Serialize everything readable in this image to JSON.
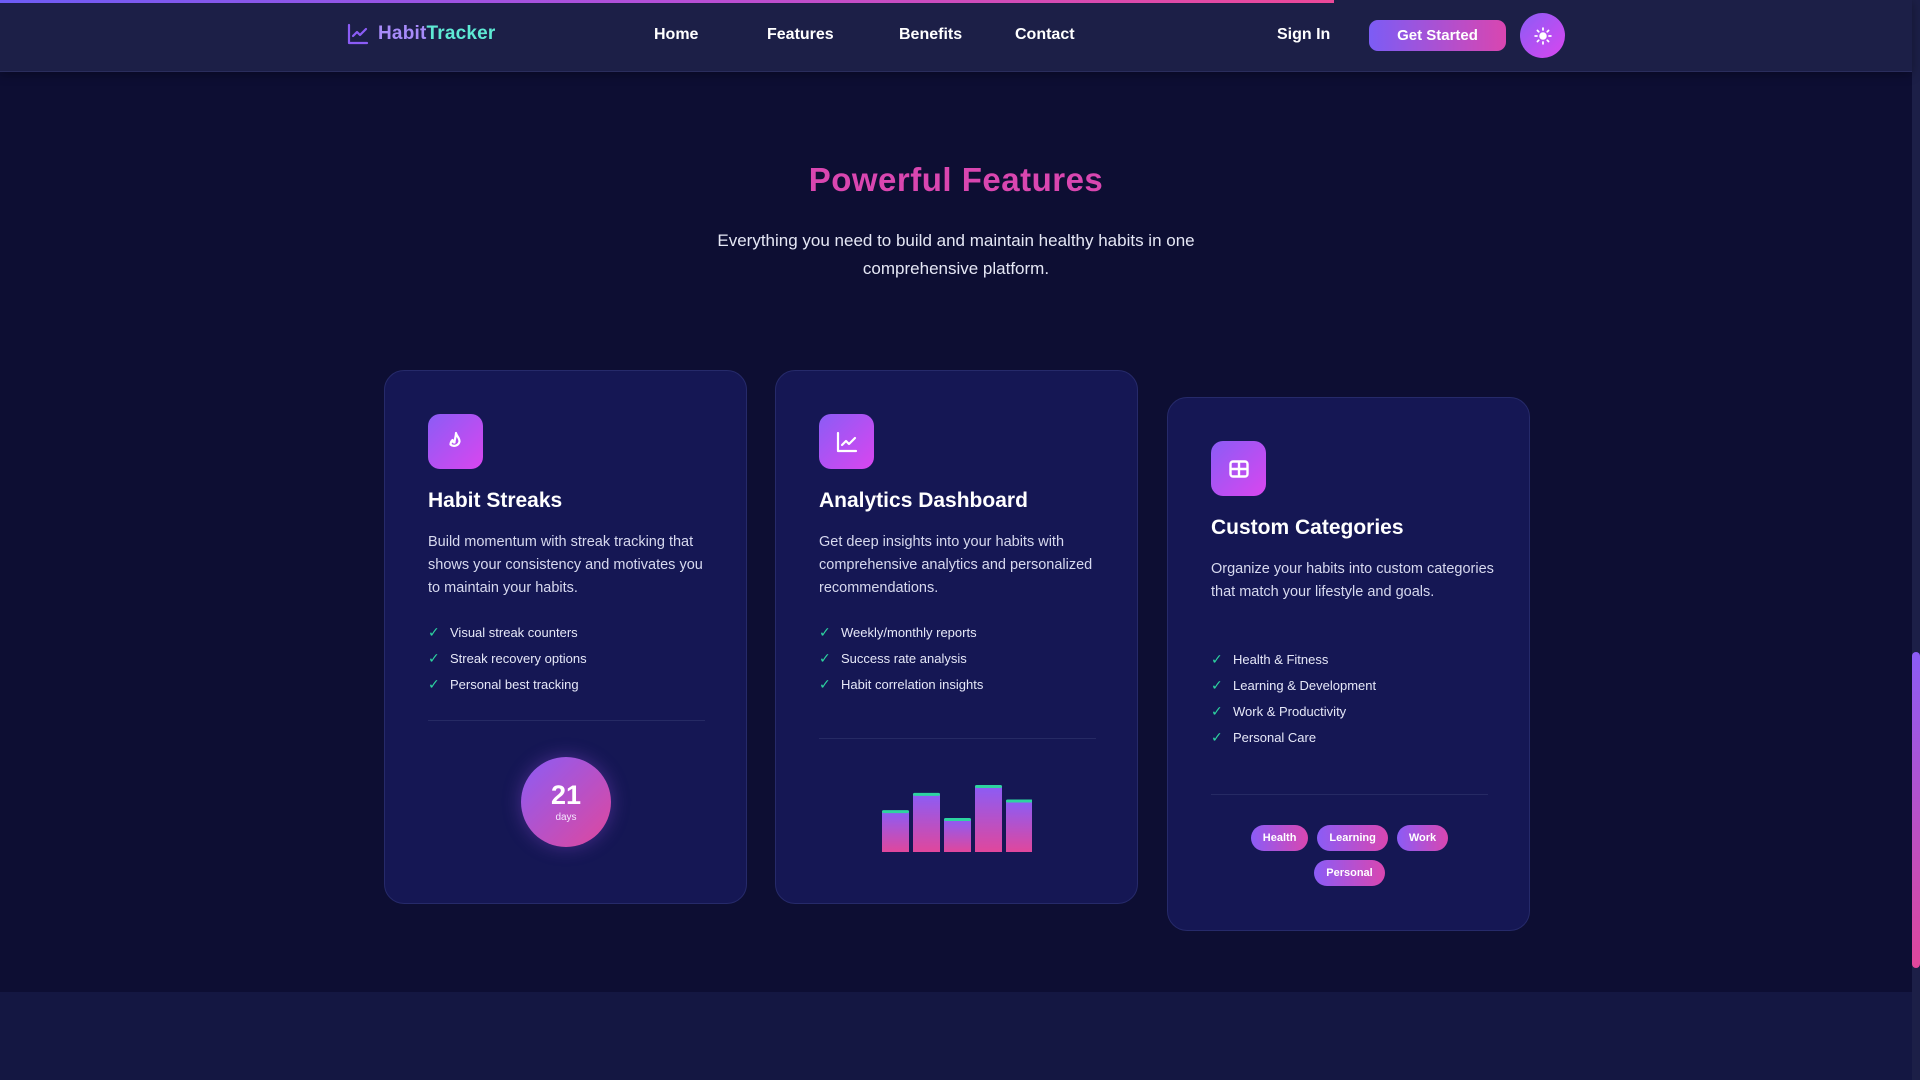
{
  "scroll_progress": 0.695,
  "brand": {
    "name_part1": "Habit",
    "name_part2": "Tracker"
  },
  "nav": {
    "links": [
      "Home",
      "Features",
      "Benefits",
      "Contact"
    ],
    "signin_label": "Sign In",
    "cta_label": "Get Started",
    "theme_toggle_icon": "sun-icon"
  },
  "section": {
    "title": "Powerful Features",
    "subtitle": "Everything you need to build and maintain healthy habits in one comprehensive platform."
  },
  "cards": [
    {
      "icon": "flame-icon",
      "title": "Habit Streaks",
      "description": "Build momentum with streak tracking that shows your consistency and motivates you to maintain your habits.",
      "features": [
        "Visual streak counters",
        "Streak recovery options",
        "Personal best tracking"
      ],
      "streak": {
        "value": "21",
        "unit": "days"
      }
    },
    {
      "icon": "chart-line-icon",
      "title": "Analytics Dashboard",
      "description": "Get deep insights into your habits with comprehensive analytics and personalized recommendations.",
      "features": [
        "Weekly/monthly reports",
        "Success rate analysis",
        "Habit correlation insights"
      ],
      "bar_levels": [
        0.62,
        0.88,
        0.5,
        1.0,
        0.78
      ]
    },
    {
      "icon": "grid-icon",
      "title": "Custom Categories",
      "description": "Organize your habits into custom categories that match your lifestyle and goals.",
      "features": [
        "Health & Fitness",
        "Learning & Development",
        "Work & Productivity",
        "Personal Care"
      ],
      "tags": [
        "Health",
        "Learning",
        "Work",
        "Personal"
      ]
    }
  ],
  "colors": {
    "accent_gradient_start": "#8b5cf6",
    "accent_gradient_end": "#d946b0",
    "check": "#2dd4a0",
    "background": "#0d0e33",
    "card": "#151754"
  }
}
